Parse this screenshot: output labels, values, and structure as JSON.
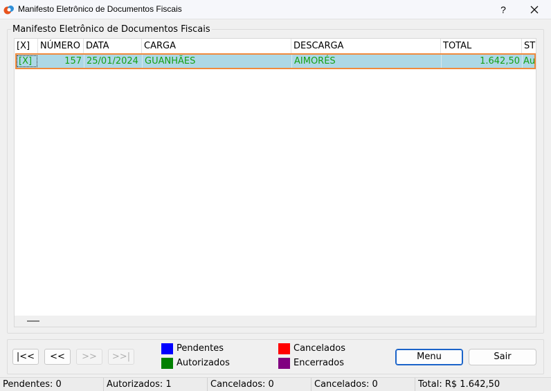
{
  "window": {
    "title": "Manifesto Eletrônico de Documentos Fiscais",
    "help_label": "?",
    "close_icon": "close-icon"
  },
  "group": {
    "title": "Manifesto Eletrônico de Documentos Fiscais"
  },
  "table": {
    "columns": [
      "[X]",
      "NÚMERO",
      "DATA",
      "CARGA",
      "DESCARGA",
      "TOTAL",
      "ST"
    ],
    "rows": [
      {
        "select": "[X]",
        "numero": "157",
        "data": "25/01/2024",
        "carga": "GUANHÃES",
        "descarga": "AIMORÉS",
        "total": "1.642,50",
        "status": "Au"
      }
    ],
    "row_text_color": "#15a015",
    "selected_row_bg": "#add8e6",
    "selected_row_border": "#f08a3c"
  },
  "navigation": {
    "first": "|<<",
    "prev": "<<",
    "next": ">>",
    "last": ">>|"
  },
  "legend": [
    {
      "label": "Pendentes",
      "color": "#0000ff"
    },
    {
      "label": "Autorizados",
      "color": "#008000"
    },
    {
      "label": "Cancelados",
      "color": "#ff0000"
    },
    {
      "label": "Encerrados",
      "color": "#800080"
    }
  ],
  "buttons": {
    "menu": "Menu",
    "exit": "Sair"
  },
  "status": {
    "pendentes": "Pendentes: 0",
    "autorizados": "Autorizados: 1",
    "cancelados_1": "Cancelados: 0",
    "cancelados_2": "Cancelados: 0",
    "total": "Total: R$ 1.642,50"
  }
}
